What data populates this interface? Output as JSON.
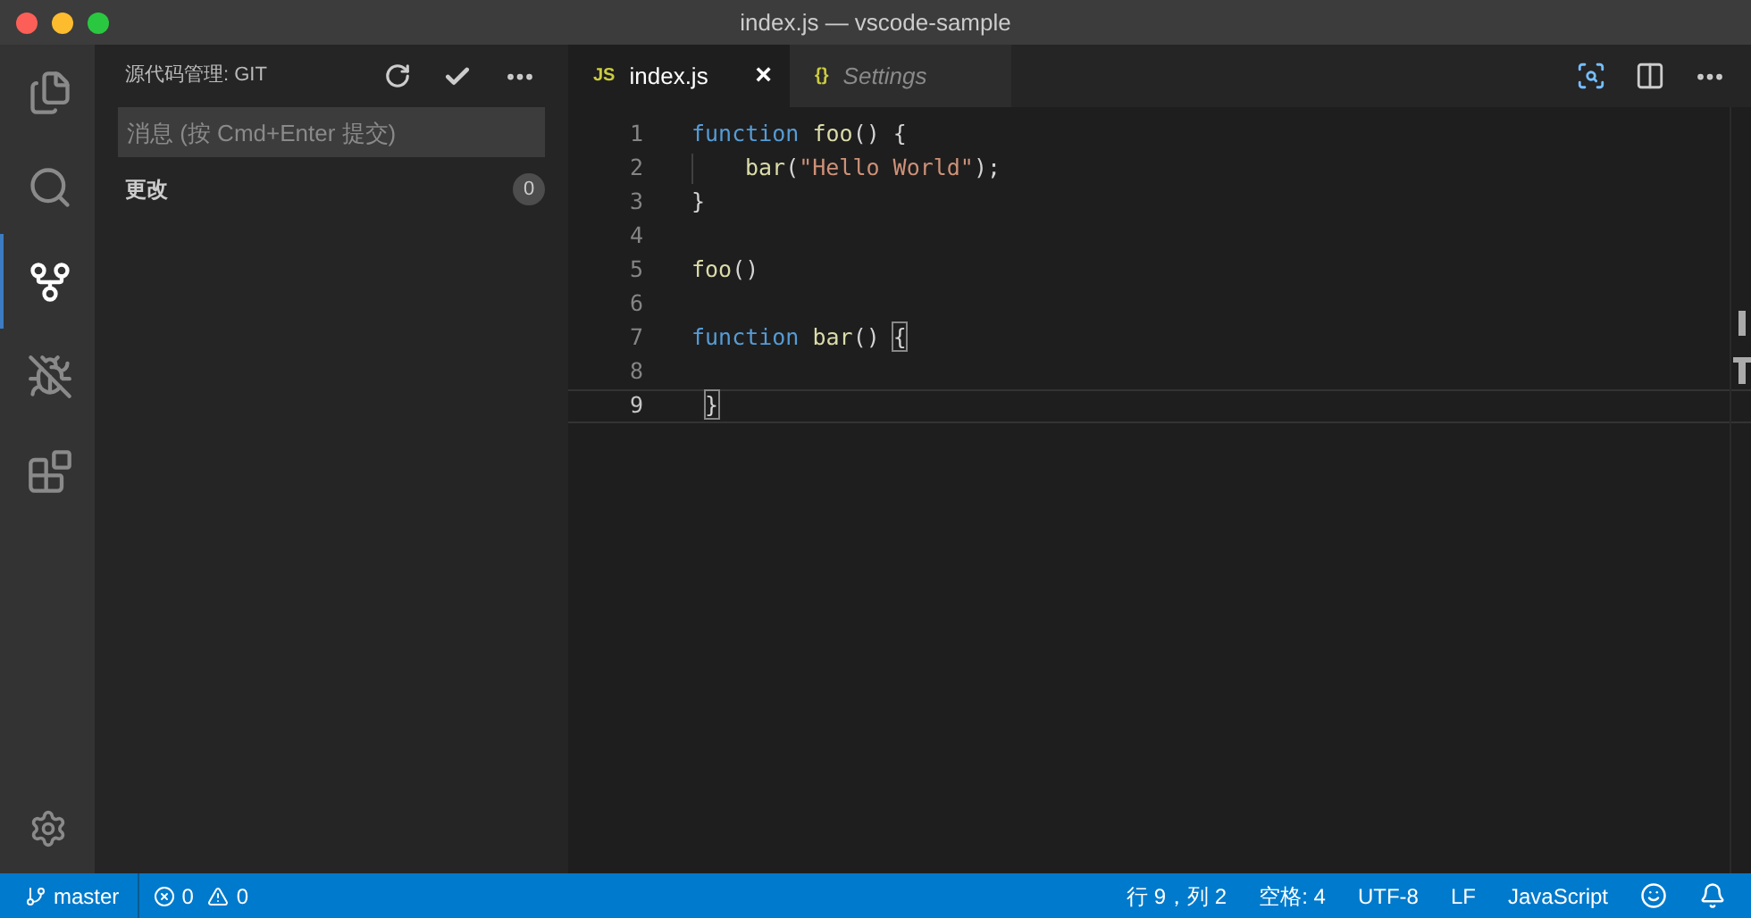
{
  "window": {
    "title": "index.js — vscode-sample"
  },
  "activity_bar": {
    "items": [
      {
        "kind": "files",
        "selected": false
      },
      {
        "kind": "search",
        "selected": false
      },
      {
        "kind": "scm",
        "selected": true
      },
      {
        "kind": "debug",
        "selected": false
      },
      {
        "kind": "extensions",
        "selected": false
      }
    ]
  },
  "sidebar": {
    "title": "源代码管理: GIT",
    "message_field": {
      "placeholder": "消息 (按 Cmd+Enter 提交)"
    },
    "changes": {
      "label": "更改",
      "count": "0"
    }
  },
  "tabs": [
    {
      "icon": "JS",
      "label": "index.js",
      "selected": true,
      "close": "×"
    },
    {
      "icon": "{}",
      "label": "Settings",
      "selected": false
    }
  ],
  "editor": {
    "lines": [
      {
        "number": "1",
        "current": false,
        "indented": false,
        "tokens": [
          {
            "kind": "keyword",
            "text": "function"
          },
          {
            "kind": "function",
            "text": " foo"
          },
          {
            "kind": "plain",
            "text": "() {"
          }
        ]
      },
      {
        "number": "2",
        "current": false,
        "indented": true,
        "tokens": [
          {
            "kind": "function",
            "text": "bar"
          },
          {
            "kind": "plain",
            "text": "("
          },
          {
            "kind": "string",
            "text": "\"Hello World\""
          },
          {
            "kind": "plain",
            "text": ");"
          }
        ]
      },
      {
        "number": "3",
        "current": false,
        "indented": false,
        "tokens": [
          {
            "kind": "plain",
            "text": "}"
          }
        ]
      },
      {
        "number": "4",
        "current": false,
        "indented": false
      },
      {
        "number": "5",
        "current": false,
        "indented": false,
        "tokens": [
          {
            "kind": "function",
            "text": "foo"
          },
          {
            "kind": "plain",
            "text": "()"
          }
        ]
      },
      {
        "number": "6",
        "current": false,
        "indented": false
      },
      {
        "number": "7",
        "current": false,
        "indented": false,
        "tokens": [
          {
            "kind": "keyword",
            "text": "function"
          },
          {
            "kind": "function",
            "text": " bar"
          },
          {
            "kind": "plain",
            "text": "()"
          },
          {
            "kind": "bracket-match",
            "text": "{"
          }
        ]
      },
      {
        "number": "8",
        "current": false,
        "indented": false
      },
      {
        "number": "9",
        "current": true,
        "indented": false,
        "tokens": [
          {
            "kind": "bracket-match",
            "text": "}"
          }
        ]
      }
    ]
  },
  "status_bar": {
    "branch": "master",
    "errors": "0",
    "warnings": "0",
    "items": [
      "行 9，列 2",
      "空格: 4",
      "UTF-8",
      "LF",
      "JavaScript"
    ]
  }
}
